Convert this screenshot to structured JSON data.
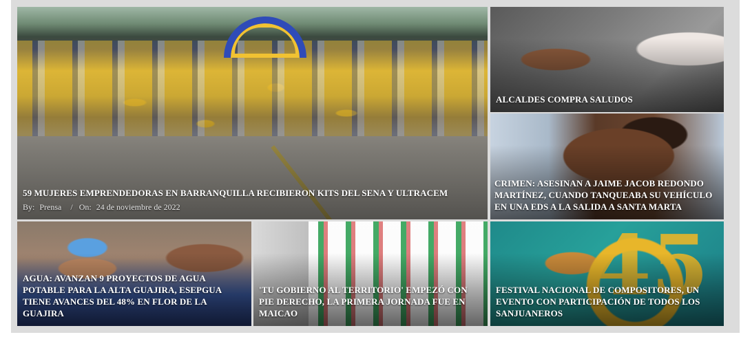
{
  "featured": {
    "title": "59 MUJERES EMPRENDEDORAS EN BARRANQUILLA RECIBIERON KITS DEL SENA Y ULTRACEM",
    "by_label": "By:",
    "author": "Prensa",
    "separator": "/",
    "on_label": "On:",
    "date": "24 de noviembre de 2022"
  },
  "tiles": {
    "alcaldes": {
      "title": "ALCALDES COMPRA SALUDOS"
    },
    "crimen": {
      "title": "CRIMEN: ASESINAN A JAIME JACOB REDONDO MARTÍNEZ, CUANDO TANQUEABA SU VEHÍCULO EN UNA EDS A LA SALIDA A SANTA MARTA"
    },
    "agua": {
      "title": "AGUA: AVANZAN 9 PROYECTOS DE AGUA POTABLE PARA LA ALTA GUAJIRA, ESEPGUA TIENE AVANCES DEL 48% EN FLOR DE LA GUAJIRA"
    },
    "gobierno": {
      "title": "'TU GOBIERNO AL TERRITORIO' EMPEZÓ CON PIE DERECHO, LA PRIMERA JORNADA FUE EN MAICAO"
    },
    "festival": {
      "title": "FESTIVAL NACIONAL DE COMPOSITORES, UN EVENTO CON PARTICIPACIÓN DE TODOS LOS SANJUANEROS",
      "badge_number": "45"
    }
  }
}
